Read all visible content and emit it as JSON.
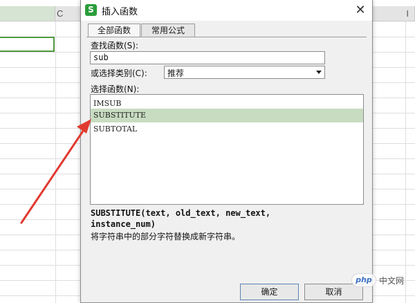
{
  "spreadsheet": {
    "column_label_b": "C",
    "column_label_right": "I"
  },
  "dialog": {
    "icon_letter": "S",
    "title": "插入函数",
    "close_glyph": "✕",
    "tabs": [
      {
        "label": "全部函数",
        "active": true
      },
      {
        "label": "常用公式",
        "active": false
      }
    ],
    "search_label": "查找函数(S):",
    "search_value": "sub",
    "category_label": "或选择类别(C):",
    "category_value": "推荐",
    "function_list_label": "选择函数(N):",
    "functions": [
      "IMSUB",
      "SUBSTITUTE",
      "SUBTOTAL"
    ],
    "selected_function": "SUBSTITUTE",
    "signature_line1": "SUBSTITUTE(text, old_text, new_text,",
    "signature_line2": "instance_num)",
    "description": "将字符串中的部分字符替换成新字符串。",
    "ok_label": "确定",
    "cancel_label": "取消"
  },
  "watermark": {
    "logo_text": "php",
    "site_text": "中文网"
  },
  "colors": {
    "selection_highlight": "#c8dcc2",
    "selected_cell_border": "#4e9a3c",
    "annotation_arrow": "#e03a2f",
    "app_icon": "#2a9d3a"
  }
}
